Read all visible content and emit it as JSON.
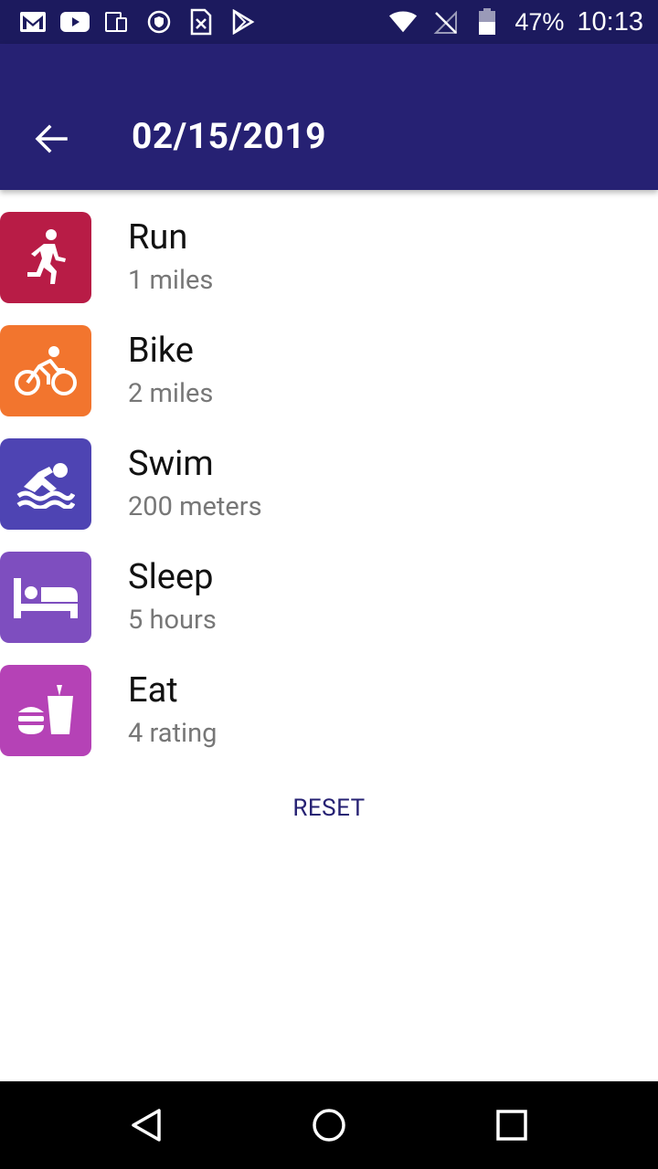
{
  "status_bar": {
    "battery_percent": "47%",
    "time": "10:13",
    "left_icons": [
      "gmail-icon",
      "youtube-icon",
      "devices-icon",
      "shield-icon",
      "sim-x-icon",
      "play-store-icon"
    ],
    "right_icons": [
      "wifi-icon",
      "no-signal-icon",
      "battery-icon"
    ]
  },
  "app_bar": {
    "title": "02/15/2019",
    "color": "#262173"
  },
  "activities": [
    {
      "label": "Run",
      "value": "1 miles",
      "color": "#b81c46",
      "icon": "run-icon"
    },
    {
      "label": "Bike",
      "value": "2 miles",
      "color": "#f2752e",
      "icon": "bike-icon"
    },
    {
      "label": "Swim",
      "value": "200 meters",
      "color": "#4e44b3",
      "icon": "swim-icon"
    },
    {
      "label": "Sleep",
      "value": "5 hours",
      "color": "#7e4ebf",
      "icon": "bed-icon"
    },
    {
      "label": "Eat",
      "value": "4 rating",
      "color": "#b542b6",
      "icon": "food-icon"
    }
  ],
  "reset_label": "RESET",
  "nav_bar": [
    "back-triangle-icon",
    "home-circle-icon",
    "recents-square-icon"
  ]
}
